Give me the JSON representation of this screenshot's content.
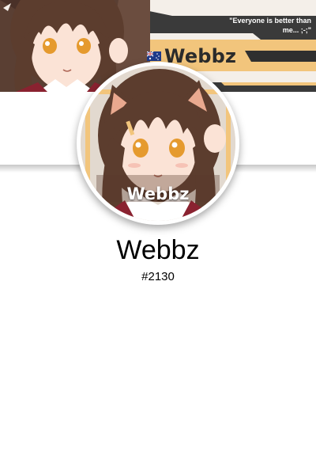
{
  "banner": {
    "quote": "\"Everyone is better than me... ;-;\"",
    "name": "Webbz",
    "flag_icon": "australia-flag-icon",
    "colors": {
      "dark": "#3a3a3a",
      "accent": "#f2c57c",
      "light": "#f4efe9"
    }
  },
  "avatar": {
    "label": "Webbz",
    "ring_color": "#ffffff"
  },
  "profile": {
    "display_name": "Webbz",
    "discriminator": "#2130"
  }
}
